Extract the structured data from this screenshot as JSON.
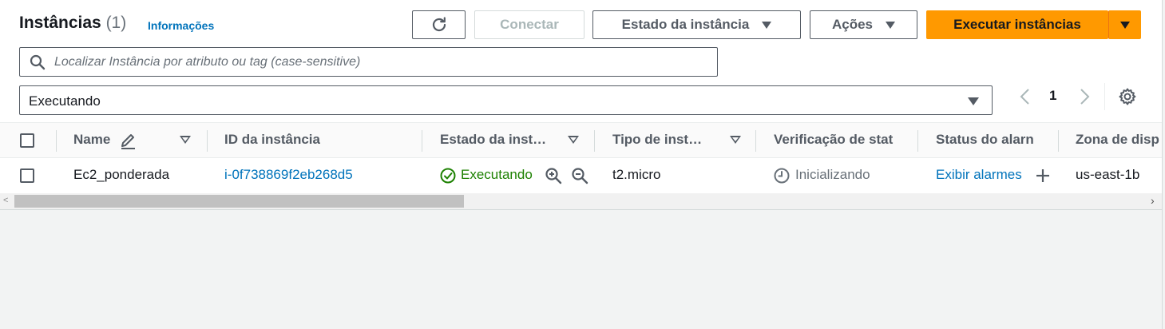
{
  "header": {
    "title": "Instâncias",
    "count": "(1)",
    "info_link": "Informações"
  },
  "toolbar": {
    "refresh_icon": "refresh-icon",
    "connect_label": "Conectar",
    "instance_state_label": "Estado da instância",
    "actions_label": "Ações",
    "launch_label": "Executar instâncias"
  },
  "search": {
    "icon": "search-icon",
    "placeholder": "Localizar Instância por atributo ou tag (case-sensitive)",
    "value": ""
  },
  "filter": {
    "selected": "Executando"
  },
  "pagination": {
    "current_page": "1"
  },
  "table": {
    "columns": [
      "Name",
      "ID da instância",
      "Estado da inst…",
      "Tipo de inst…",
      "Verificação de stat",
      "Status do alarn",
      "Zona de disp"
    ],
    "rows": [
      {
        "name": "Ec2_ponderada",
        "instance_id": "i-0f738869f2eb268d5",
        "state": "Executando",
        "type": "t2.micro",
        "status_check": "Inicializando",
        "alarm_status": "Exibir alarmes",
        "zone": "us-east-1b"
      }
    ]
  },
  "colors": {
    "primary": "#ff9900",
    "link": "#0073bb",
    "success": "#1d8102",
    "muted": "#687078"
  }
}
